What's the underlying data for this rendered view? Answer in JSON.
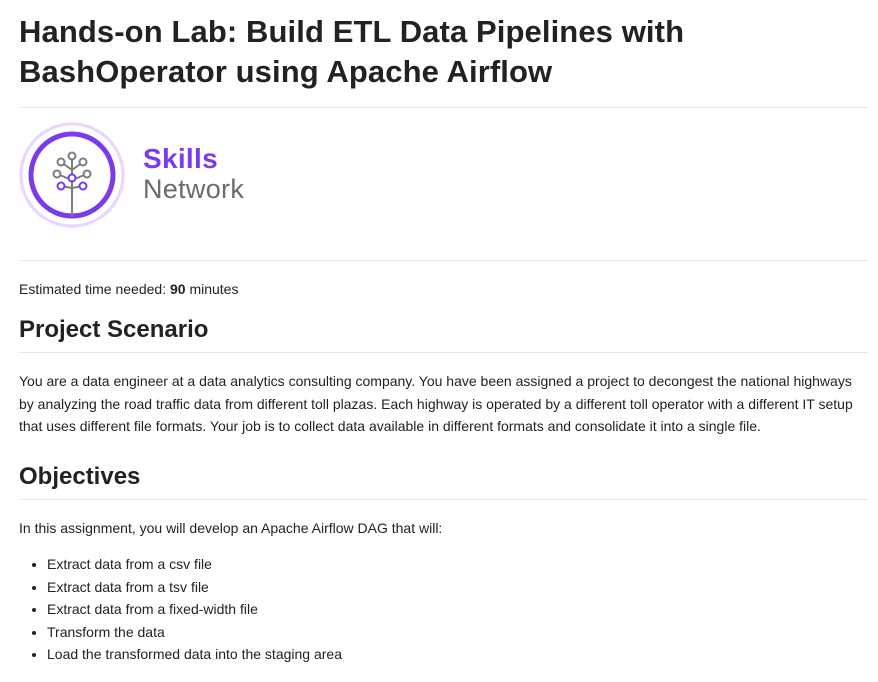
{
  "header": {
    "title": "Hands-on Lab: Build ETL Data Pipelines with BashOperator using Apache Airflow"
  },
  "logo": {
    "word1": "Skills",
    "word2": "Network",
    "colors": {
      "accent": "#7c3aed",
      "ring_light": "#e9d5ff",
      "gray": "#6b6b6b"
    }
  },
  "estimate": {
    "prefix": "Estimated time needed: ",
    "value": "90",
    "suffix": " minutes"
  },
  "scenario": {
    "heading": "Project Scenario",
    "text": "You are a data engineer at a data analytics consulting company. You have been assigned a project to decongest the national highways by analyzing the road traffic data from different toll plazas. Each highway is operated by a different toll operator with a different IT setup that uses different file formats. Your job is to collect data available in different formats and consolidate it into a single file."
  },
  "objectives": {
    "heading": "Objectives",
    "intro": "In this assignment, you will develop an Apache Airflow DAG that will:",
    "items": [
      "Extract data from a csv file",
      "Extract data from a tsv file",
      "Extract data from a fixed-width file",
      "Transform the data",
      "Load the transformed data into the staging area"
    ]
  }
}
